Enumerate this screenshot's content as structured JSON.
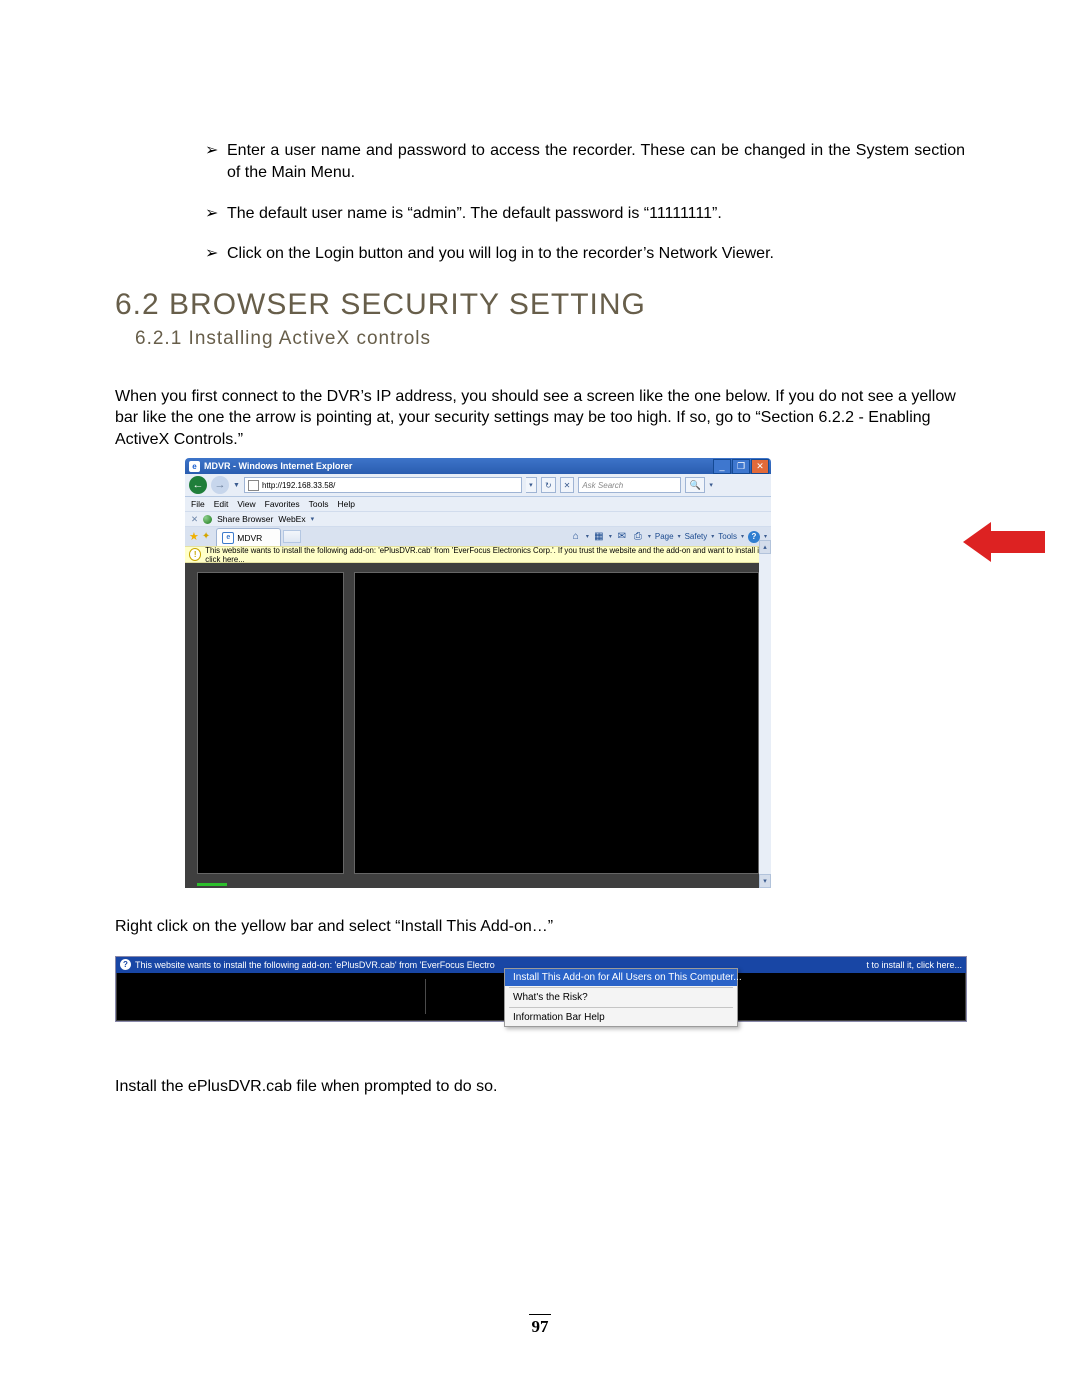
{
  "bullets": [
    "Enter a user name and password to access the recorder. These can be changed in the System section of the Main Menu.",
    "The default user name is “admin”. The default password is “11111111”.",
    "Click on the Login button and you will log in to the recorder’s Network Viewer."
  ],
  "section_heading": "6.2  BROWSER SECURITY SETTING",
  "subsection_heading": "6.2.1 Installing ActiveX controls",
  "intro_paragraph": "When you first connect to the DVR’s IP address, you should see a screen like the one below. If you do not see a yellow bar like the one the arrow is pointing at, your security settings may be too high. If so, go to “Section 6.2.2 - Enabling ActiveX Controls.”",
  "fig1": {
    "title": "MDVR - Windows Internet Explorer",
    "address": "http://192.168.33.58/",
    "search_placeholder": "Ask Search",
    "menu": {
      "file": "File",
      "edit": "Edit",
      "view": "View",
      "favorites": "Favorites",
      "tools": "Tools",
      "help": "Help"
    },
    "share": {
      "label": "Share Browser",
      "app": "WebEx"
    },
    "tab_label": "MDVR",
    "cmds": {
      "page": "Page",
      "safety": "Safety",
      "tools": "Tools"
    },
    "infobar": "This website wants to install the following add-on: 'ePlusDVR.cab' from 'EverFocus Electronics Corp.'. If you trust the website and the add-on and want to install it, click here..."
  },
  "mid_paragraph": "Right click on the yellow bar and select “Install This Add-on…”",
  "fig2": {
    "infobar_left": "This website wants to install the following add-on: 'ePlusDVR.cab' from 'EverFocus Electro",
    "infobar_right": "t to install it, click here...",
    "menu": {
      "install": "Install This Add-on for All Users on This Computer...",
      "risk": "What's the Risk?",
      "help": "Information Bar Help"
    }
  },
  "last_paragraph": "Install the ePlusDVR.cab file when prompted to do so.",
  "page_number": "97"
}
